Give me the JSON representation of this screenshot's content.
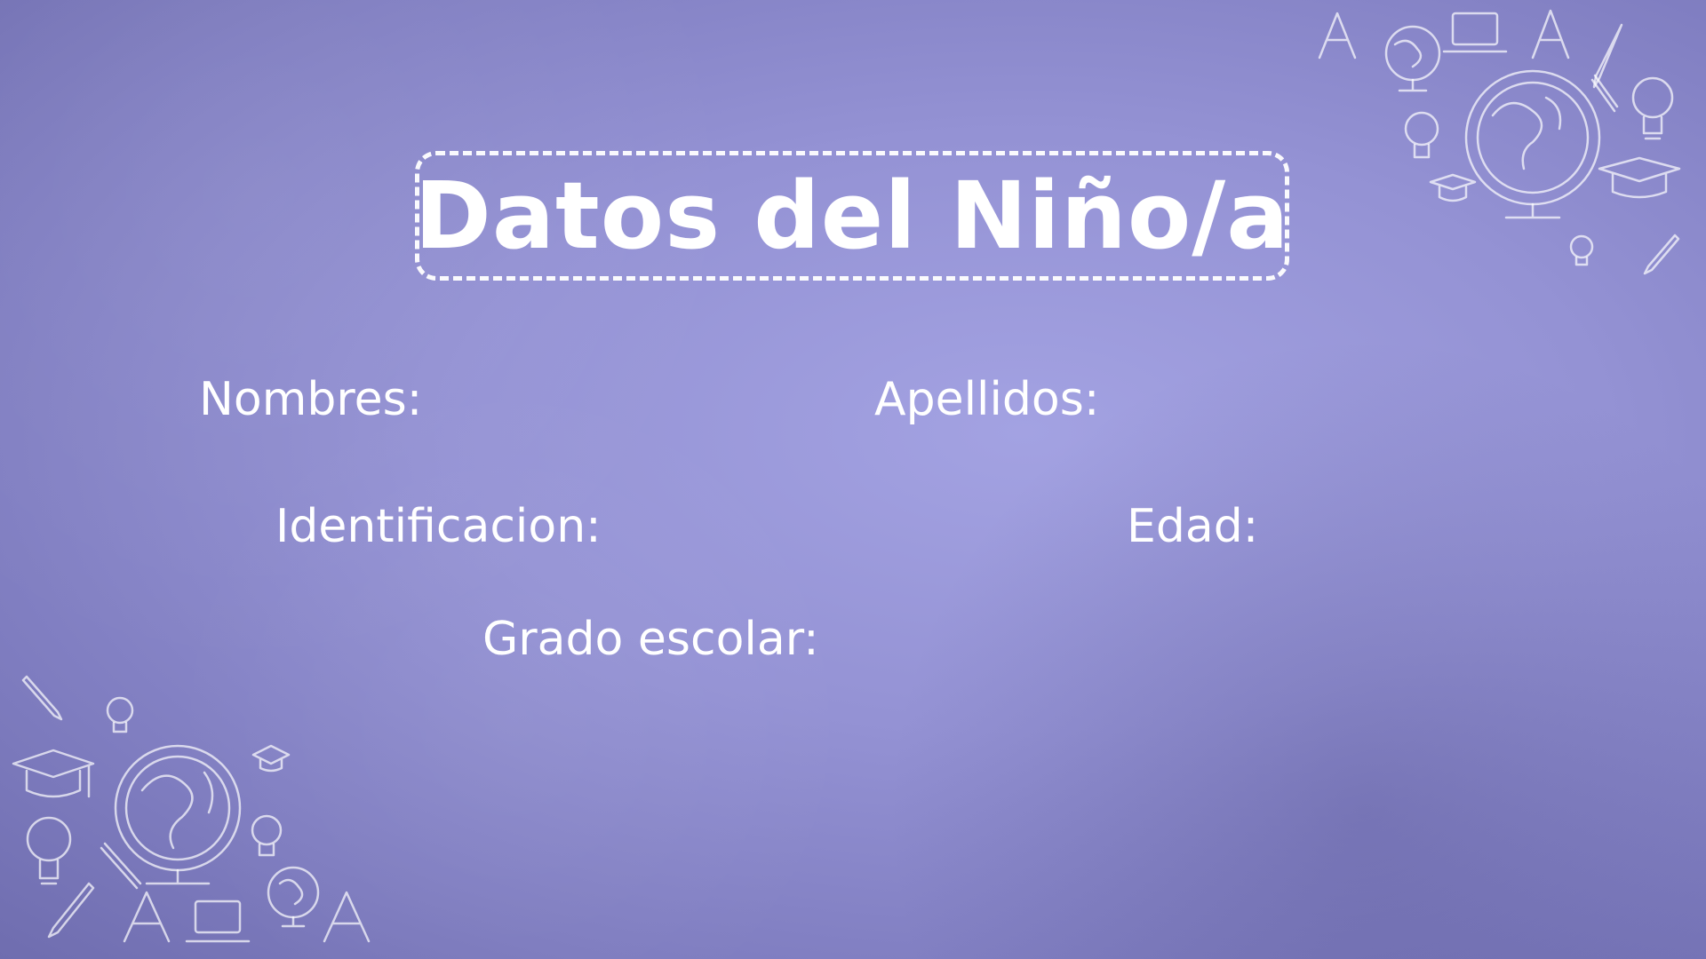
{
  "title": "Datos del Niño/a",
  "fields": {
    "nombres": "Nombres:",
    "apellidos": "Apellidos:",
    "identificacion": "Identificacion:",
    "edad": "Edad:",
    "grado": "Grado escolar:"
  },
  "colors": {
    "background": "#9492d4",
    "text": "#ffffff"
  },
  "decorations": [
    "letter-a-icon",
    "globe-icon",
    "laptop-icon",
    "pencil-icon",
    "light-bulb-icon",
    "graduation-cap-icon"
  ]
}
